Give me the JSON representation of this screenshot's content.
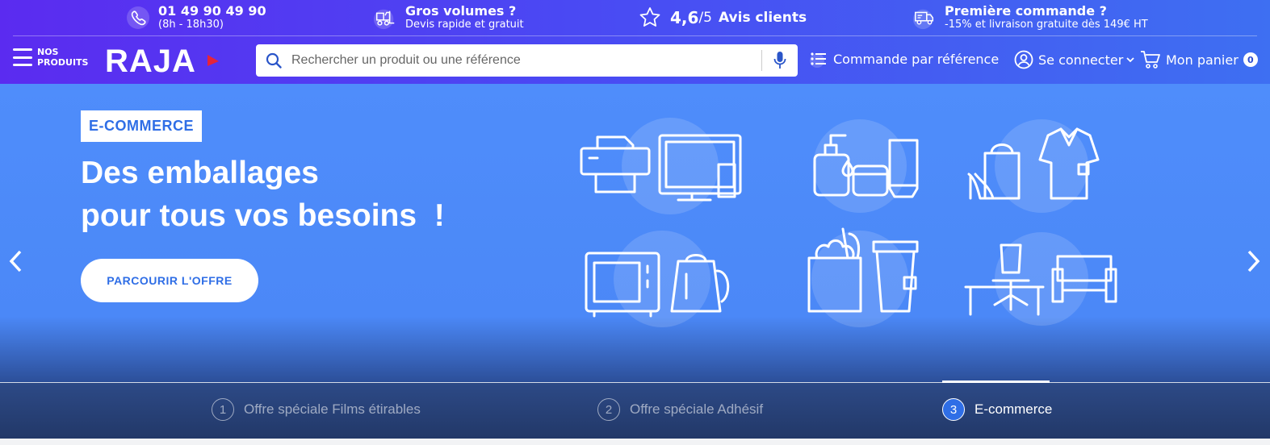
{
  "topbar": {
    "phone": {
      "number": "01 49 90 49 90",
      "hours": "(8h - 18h30)"
    },
    "volume": {
      "title": "Gros volumes ?",
      "subtitle": "Devis rapide et gratuit"
    },
    "rating": {
      "score": "4,6",
      "scale": "/5",
      "label": "Avis clients"
    },
    "first_order": {
      "title": "Première commande ?",
      "subtitle": "-15% et livraison gratuite dès 149€ HT"
    }
  },
  "nav": {
    "menu_line1": "NOS",
    "menu_line2": "PRODUITS",
    "logo": "RAJA",
    "search_placeholder": "Rechercher un produit ou une référence",
    "order_by_ref": "Commande par référence",
    "login": "Se connecter",
    "cart": "Mon panier",
    "cart_count": "0"
  },
  "hero": {
    "tag": "E-COMMERCE",
    "headline_line1": "Des emballages",
    "headline_line2": "pour tous vos besoins  !",
    "cta": "PARCOURIR L'OFFRE"
  },
  "slider": {
    "tabs": [
      {
        "num": "1",
        "label": "Offre spéciale Films étirables",
        "active": false
      },
      {
        "num": "2",
        "label": "Offre spéciale Adhésif",
        "active": false
      },
      {
        "num": "3",
        "label": "E-commerce",
        "active": true
      }
    ]
  },
  "colors": {
    "brand_gradient_start": "#5b2bf0",
    "brand_gradient_end": "#3e6ff2",
    "hero_blue": "#4f8dfb",
    "accent_blue": "#2f6ee6",
    "logo_red": "#e5243b"
  }
}
